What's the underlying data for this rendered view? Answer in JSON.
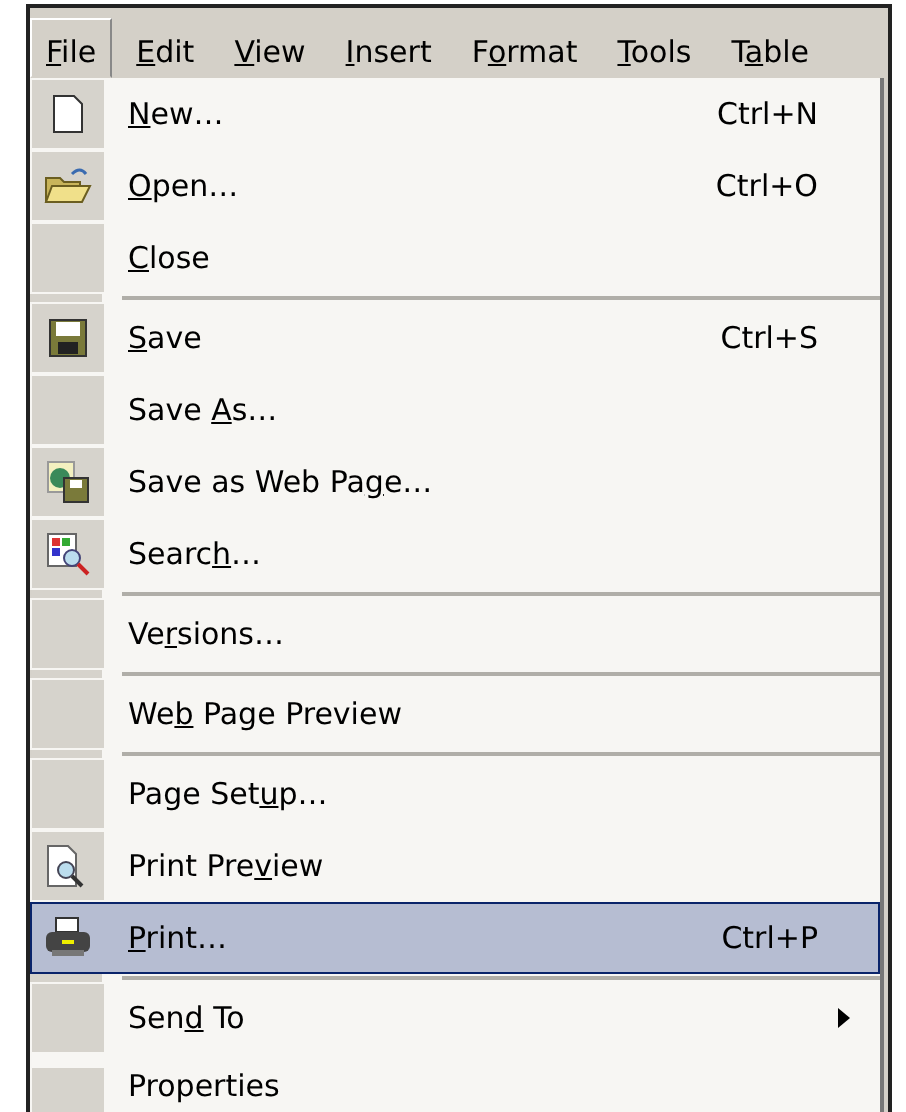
{
  "menu_bar": [
    {
      "label": {
        "key": "F",
        "after": "ile"
      },
      "selected": true
    },
    {
      "label": {
        "key": "E",
        "after": "dit"
      },
      "selected": false
    },
    {
      "label": {
        "key": "V",
        "after": "iew"
      },
      "selected": false
    },
    {
      "label": {
        "key": "I",
        "after": "nsert"
      },
      "selected": false
    },
    {
      "label": {
        "before": "F",
        "key": "o",
        "after": "rmat"
      },
      "selected": false
    },
    {
      "label": {
        "key": "T",
        "after": "ools"
      },
      "selected": false
    },
    {
      "label": {
        "before": "T",
        "key": "a",
        "after": "ble"
      },
      "selected": false
    }
  ],
  "file_menu": [
    {
      "kind": "item",
      "label": {
        "key": "N",
        "after": "ew…"
      },
      "shortcut": "Ctrl+N",
      "selected": false
    },
    {
      "kind": "item",
      "label": {
        "key": "O",
        "after": "pen…"
      },
      "shortcut": "Ctrl+O",
      "selected": false
    },
    {
      "kind": "item",
      "label": {
        "key": "C",
        "after": "lose"
      },
      "selected": false
    },
    {
      "kind": "separator"
    },
    {
      "kind": "item",
      "label": {
        "key": "S",
        "after": "ave"
      },
      "shortcut": "Ctrl+S",
      "selected": false
    },
    {
      "kind": "item",
      "label": {
        "before": "Save ",
        "key": "A",
        "after": "s…"
      },
      "selected": false
    },
    {
      "kind": "item",
      "label": {
        "before": "Save as Web Pa",
        "key": "g",
        "after": "e…"
      },
      "selected": false
    },
    {
      "kind": "item",
      "label": {
        "before": "Searc",
        "key": "h",
        "after": "…"
      },
      "selected": false
    },
    {
      "kind": "separator"
    },
    {
      "kind": "item",
      "label": {
        "before": "Ve",
        "key": "r",
        "after": "sions…"
      },
      "selected": false
    },
    {
      "kind": "separator"
    },
    {
      "kind": "item",
      "label": {
        "before": "We",
        "key": "b",
        "after": " Page Preview"
      },
      "selected": false
    },
    {
      "kind": "separator"
    },
    {
      "kind": "item",
      "label": {
        "before": "Page Set",
        "key": "u",
        "after": "p…"
      },
      "selected": false
    },
    {
      "kind": "item",
      "label": {
        "before": "Print Pre",
        "key": "v",
        "after": "iew"
      },
      "selected": false
    },
    {
      "kind": "item",
      "label": {
        "key": "P",
        "after": "rint…"
      },
      "shortcut": "Ctrl+P",
      "selected": true
    },
    {
      "kind": "separator"
    },
    {
      "kind": "item",
      "label": {
        "before": "Sen",
        "key": "d",
        "after": " To"
      },
      "submenu": true,
      "selected": false
    },
    {
      "kind": "item",
      "label": {
        "before": "Properties"
      },
      "selected": false
    }
  ]
}
